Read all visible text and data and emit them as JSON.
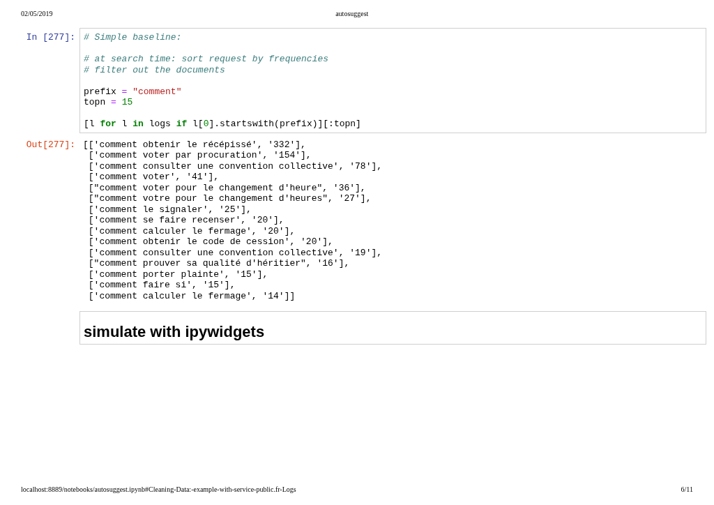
{
  "print_header": {
    "date": "02/05/2019",
    "title": "autosuggest"
  },
  "input_cell": {
    "prompt": "In [277]:",
    "lines": [
      {
        "lines": [
          [
            {
              "kind": "comment",
              "text": "# Simple baseline:"
            }
          ]
        ]
      },
      {
        "lines": [
          [
            {
              "kind": "comment",
              "text": "# at search time: sort request by frequencies"
            }
          ],
          [
            {
              "kind": "comment",
              "text": "# filter out the documents"
            }
          ]
        ]
      },
      {
        "lines": [
          [
            {
              "kind": "plain",
              "text": "prefix "
            },
            {
              "kind": "operator",
              "text": "= "
            },
            {
              "kind": "string",
              "text": "\"comment\""
            }
          ],
          [
            {
              "kind": "plain",
              "text": "topn "
            },
            {
              "kind": "operator",
              "text": "= "
            },
            {
              "kind": "number",
              "text": "15"
            }
          ]
        ]
      },
      {
        "lines": [
          [
            {
              "kind": "plain",
              "text": "[l "
            },
            {
              "kind": "keyword",
              "text": "for"
            },
            {
              "kind": "plain",
              "text": " l "
            },
            {
              "kind": "keyword",
              "text": "in"
            },
            {
              "kind": "plain",
              "text": " logs "
            },
            {
              "kind": "keyword",
              "text": "if"
            },
            {
              "kind": "plain",
              "text": " l["
            },
            {
              "kind": "number",
              "text": "0"
            },
            {
              "kind": "plain",
              "text": "].startswith(prefix)][:topn]"
            }
          ]
        ]
      }
    ]
  },
  "output_cell": {
    "prompt": "Out[277]:",
    "lines": [
      "[['comment obtenir le récépissé', '332'],",
      " ['comment voter par procuration', '154'],",
      " ['comment consulter une convention collective', '78'],",
      " ['comment voter', '41'],",
      " [\"comment voter pour le changement d'heure\", '36'],",
      " [\"comment votre pour le changement d'heures\", '27'],",
      " ['comment le signaler', '25'],",
      " ['comment se faire recenser', '20'],",
      " ['comment calculer le fermage', '20'],",
      " ['comment obtenir le code de cession', '20'],",
      " ['comment consulter une convention collective', '19'],",
      " [\"comment prouver sa qualité d'héritier\", '16'],",
      " ['comment porter plainte', '15'],",
      " ['comment faire si', '15'],",
      " ['comment calculer le fermage', '14']]"
    ]
  },
  "markdown_cell": {
    "heading": "simulate with ipywidgets"
  },
  "print_footer": {
    "url": "localhost:8889/notebooks/autosuggest.ipynb#Cleaning-Data:-example-with-service-public.fr-Logs",
    "page": "6/11"
  }
}
